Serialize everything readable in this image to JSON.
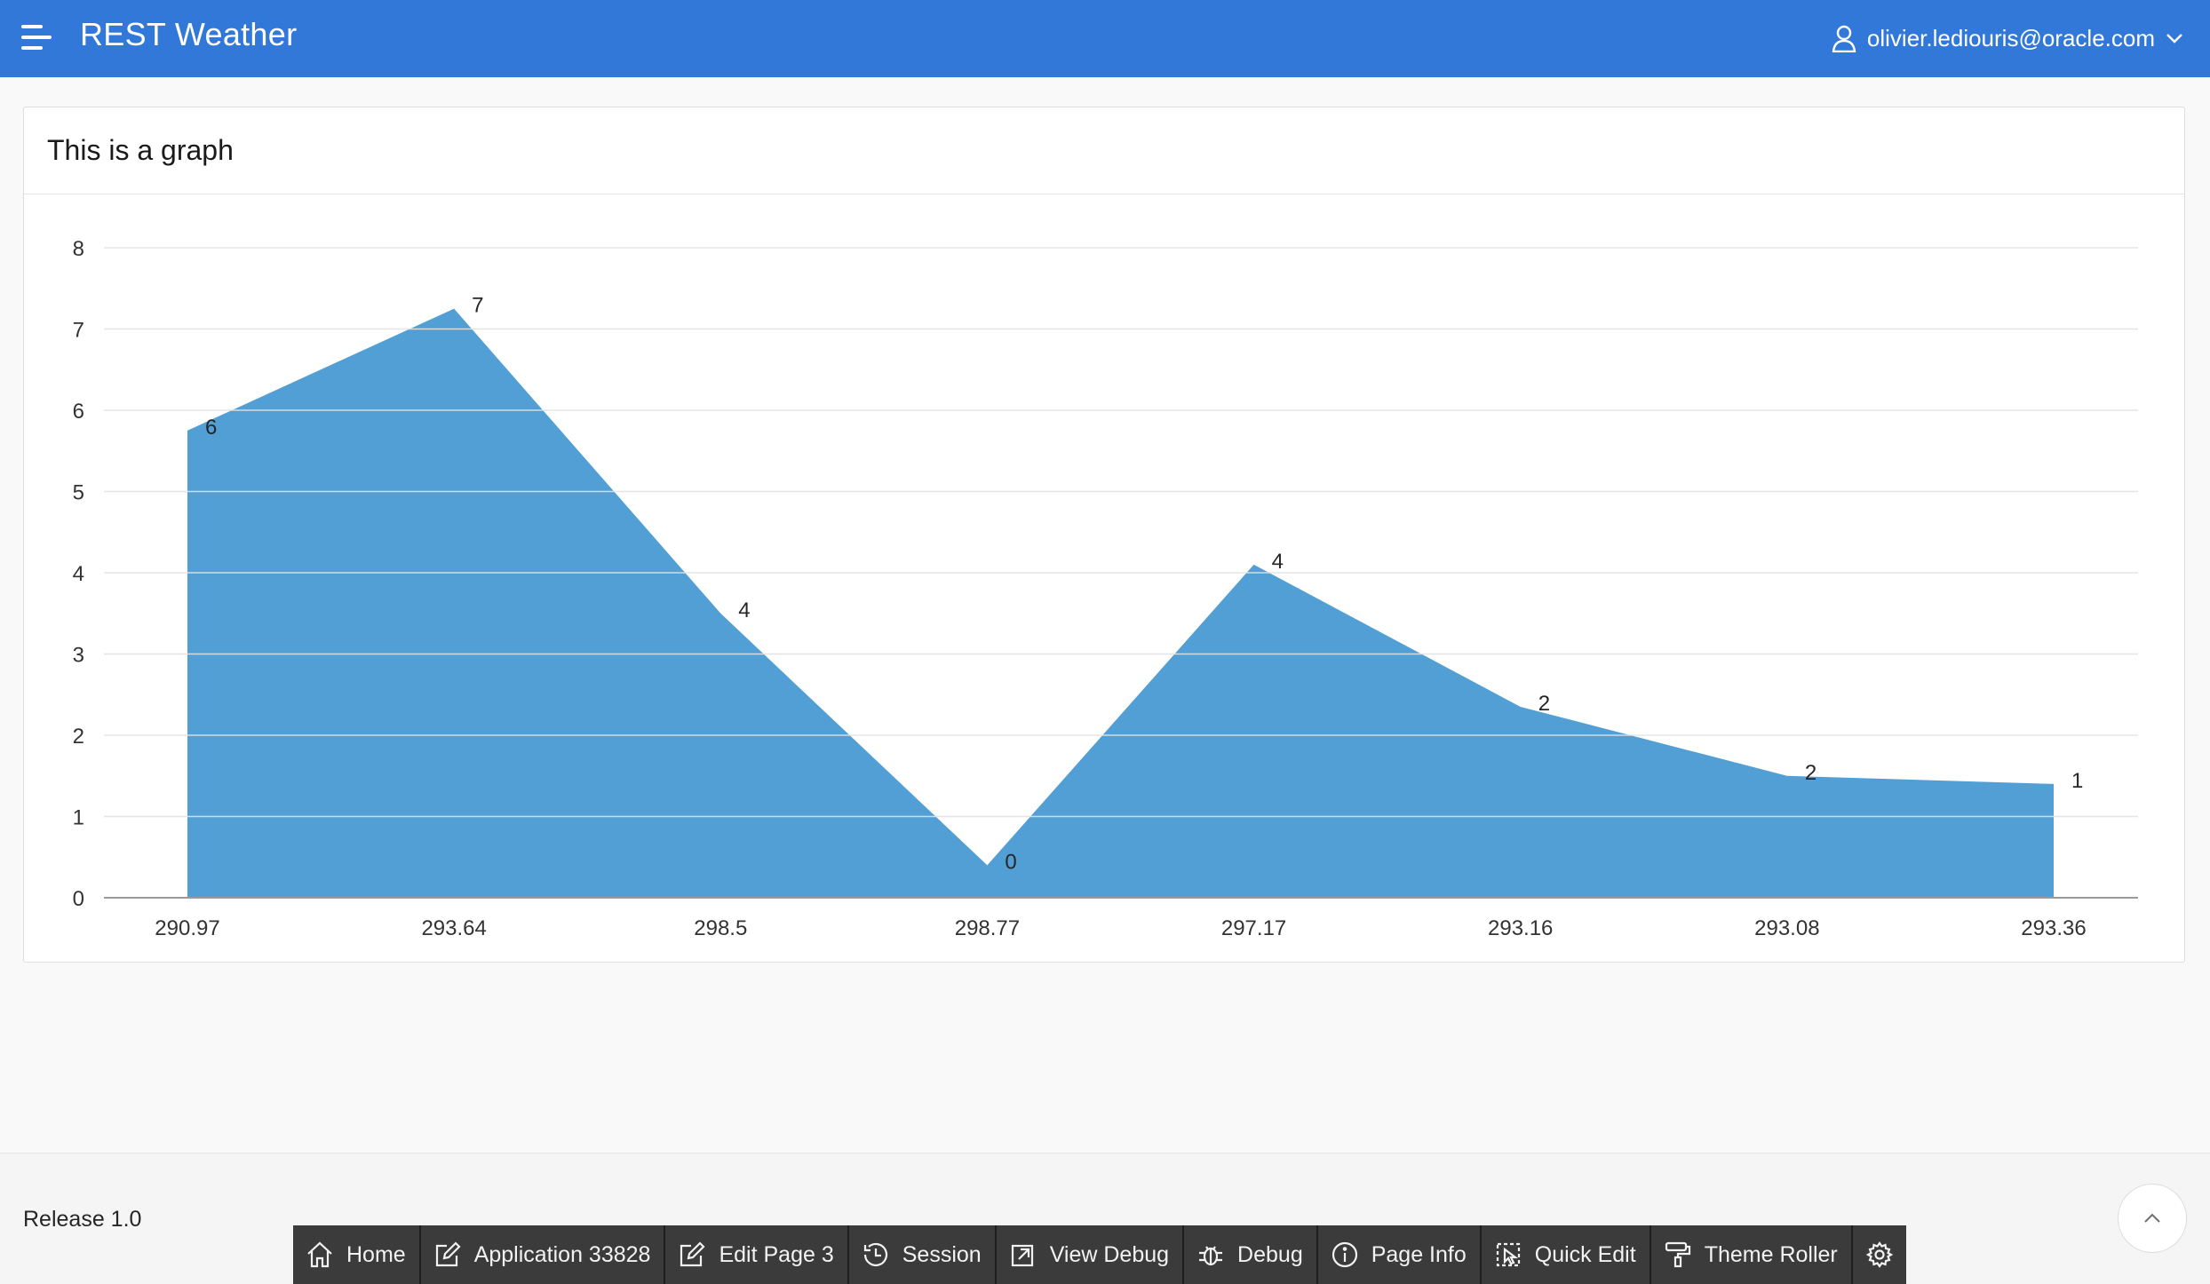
{
  "header": {
    "app_title": "REST Weather",
    "user": "olivier.lediouris@oracle.com",
    "icons": {
      "menu": "hamburger-icon",
      "user": "user-icon",
      "caret": "chevron-down-icon"
    }
  },
  "region": {
    "title": "This is a graph"
  },
  "chart_data": {
    "type": "area",
    "categories": [
      "290.97",
      "293.64",
      "298.5",
      "298.77",
      "297.17",
      "293.16",
      "293.08",
      "293.36"
    ],
    "values": [
      5.75,
      7.25,
      3.5,
      0.4,
      4.1,
      2.35,
      1.5,
      1.4
    ],
    "data_labels": [
      "6",
      "7",
      "4",
      "0",
      "4",
      "2",
      "2",
      "1"
    ],
    "y_ticks": [
      "0",
      "1",
      "2",
      "3",
      "4",
      "5",
      "6",
      "7",
      "8"
    ],
    "ylim": [
      0,
      8
    ],
    "grid": true,
    "legend": false,
    "color": "#529fd6",
    "title": "",
    "xlabel": "",
    "ylabel": ""
  },
  "footer": {
    "release": "Release 1.0",
    "scroll_top_icon": "chevron-up-icon"
  },
  "dev_toolbar": {
    "items": [
      {
        "label": "Home",
        "icon": "home-icon"
      },
      {
        "label": "Application 33828",
        "icon": "edit-icon"
      },
      {
        "label": "Edit Page 3",
        "icon": "edit-icon"
      },
      {
        "label": "Session",
        "icon": "clock-icon"
      },
      {
        "label": "View Debug",
        "icon": "external-link-icon"
      },
      {
        "label": "Debug",
        "icon": "bug-icon"
      },
      {
        "label": "Page Info",
        "icon": "info-icon"
      },
      {
        "label": "Quick Edit",
        "icon": "pointer-select-icon"
      },
      {
        "label": "Theme Roller",
        "icon": "paint-roller-icon"
      }
    ],
    "settings_icon": "gear-icon"
  }
}
